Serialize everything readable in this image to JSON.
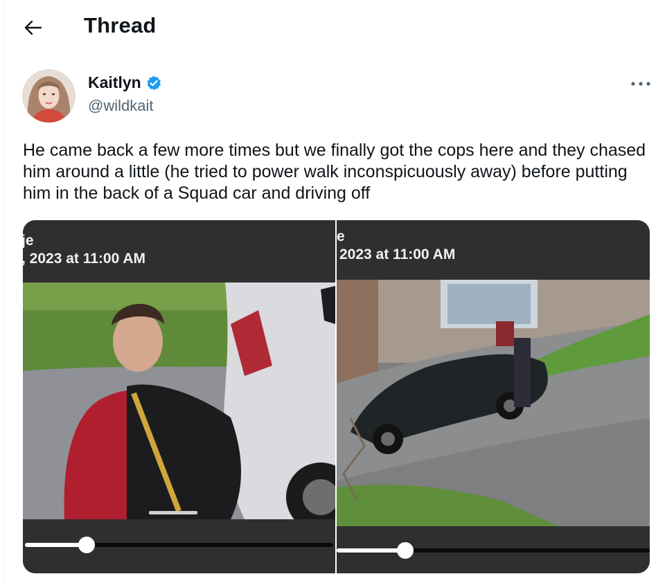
{
  "header": {
    "title": "Thread"
  },
  "author": {
    "name": "Kaitlyn",
    "handle": "@wildkait"
  },
  "tweet": {
    "text": "He came back a few more times but we finally got the cops here and they chased him around a little (he tried to power walk inconspicuously away) before putting him in the back of a Squad car and driving off"
  },
  "media": {
    "left_video": {
      "title_fragment": "je",
      "timestamp": ", 2023 at 11:00 AM",
      "progress": 0.2
    },
    "right_video": {
      "title_fragment": "e",
      "timestamp": "2023 at 11:00 AM",
      "progress": 0.22
    }
  },
  "colors": {
    "verified": "#1d9bf0",
    "text": "#0f1419",
    "secondary": "#536471"
  },
  "icons": [
    "back-arrow-icon",
    "verified-badge-icon",
    "more-icon"
  ]
}
